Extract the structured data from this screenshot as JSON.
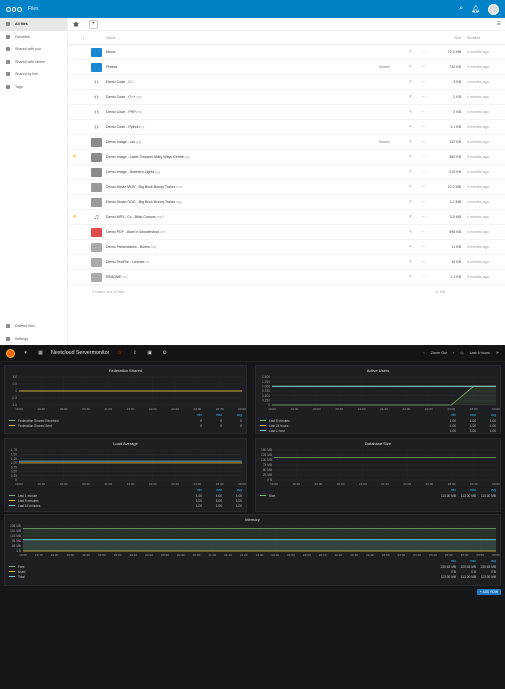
{
  "nextcloud": {
    "app_title": "Files",
    "sidebar": {
      "items": [
        {
          "label": "All files"
        },
        {
          "label": "Favorites"
        },
        {
          "label": "Shared with you"
        },
        {
          "label": "Shared with others"
        },
        {
          "label": "Shared by link"
        },
        {
          "label": "Tags"
        }
      ],
      "bottom_items": [
        {
          "label": "Deleted files"
        },
        {
          "label": "Settings"
        }
      ]
    },
    "list_header": {
      "name": "Name",
      "size": "Size",
      "modified": "Modified"
    },
    "files": [
      {
        "icon": "folder-icon",
        "type": "folder",
        "name": "Music",
        "ext": "",
        "share": "",
        "size": "70.3 MB",
        "modified": "4 months ago",
        "favorite": false
      },
      {
        "icon": "folder-icon",
        "type": "folder",
        "name": "Photos",
        "ext": "",
        "share": "Shared",
        "size": "732 KB",
        "modified": "4 months ago",
        "favorite": false
      },
      {
        "icon": "code-icon",
        "type": "code",
        "name": "Demo Code - C",
        "ext": ".c",
        "share": "",
        "size": "3 KB",
        "modified": "4 months ago",
        "favorite": false
      },
      {
        "icon": "code-icon",
        "type": "code",
        "name": "Demo Code - C++",
        "ext": ".cpp",
        "share": "",
        "size": "2 KB",
        "modified": "4 months ago",
        "favorite": false
      },
      {
        "icon": "code-icon",
        "type": "code",
        "name": "Demo Code - PHP",
        "ext": ".php",
        "share": "",
        "size": "2 KB",
        "modified": "4 months ago",
        "favorite": false
      },
      {
        "icon": "code-icon",
        "type": "code",
        "name": "Demo Code - Python",
        "ext": ".py",
        "share": "",
        "size": "1.1 KB",
        "modified": "4 months ago",
        "favorite": false
      },
      {
        "icon": "image-icon",
        "type": "image",
        "name": "Demo Image - ccc",
        "ext": ".jpg",
        "share": "Shared",
        "size": "132 KB",
        "modified": "4 months ago",
        "favorite": false
      },
      {
        "icon": "image-icon",
        "type": "image",
        "name": "Demo Image - Laser Towards Milky Ways Centre",
        "ext": ".jpg",
        "share": "",
        "size": "360 KB",
        "modified": "4 months ago",
        "favorite": true
      },
      {
        "icon": "image-icon",
        "type": "image",
        "name": "Demo Image - Northern Lights",
        "ext": ".jpg",
        "share": "",
        "size": "219 KB",
        "modified": "4 months ago",
        "favorite": false
      },
      {
        "icon": "video-icon",
        "type": "video",
        "name": "Demo Movie MOV - Big Buck Bunny Trailer",
        "ext": ".mov",
        "share": "",
        "size": "10.2 MB",
        "modified": "4 months ago",
        "favorite": false
      },
      {
        "icon": "video-icon",
        "type": "video",
        "name": "Demo Movie OGG - Big Buck Bunny Trailer",
        "ext": ".ogg",
        "share": "",
        "size": "4.2 MB",
        "modified": "4 months ago",
        "favorite": false
      },
      {
        "icon": "audio-icon",
        "type": "audio",
        "name": "Demo MP3 - Cc - Blick Cursors",
        "ext": ".mp3",
        "share": "",
        "size": "3.5 MB",
        "modified": "4 months ago",
        "favorite": true
      },
      {
        "icon": "pdf-icon",
        "type": "pdf",
        "name": "Demo PDF - Alice in Wonderland",
        "ext": ".pdf",
        "share": "",
        "size": "695 KB",
        "modified": "4 months ago",
        "favorite": false
      },
      {
        "icon": "document-icon",
        "type": "doc",
        "name": "Demo Presentation - Boxes",
        "ext": ".key",
        "share": "",
        "size": "11 KB",
        "modified": "4 months ago",
        "favorite": false
      },
      {
        "icon": "document-icon",
        "type": "doc",
        "name": "Demo TextFile - License",
        "ext": ".txt",
        "share": "",
        "size": "35 KB",
        "modified": "4 months ago",
        "favorite": false
      },
      {
        "icon": "document-icon",
        "type": "doc",
        "name": "README",
        "ext": ".md",
        "share": "",
        "size": "1.1 KB",
        "modified": "4 months ago",
        "favorite": false
      }
    ],
    "summary": {
      "count": "2 folders and 14 files",
      "total": "91 MB"
    }
  },
  "grafana": {
    "dashboard_title": "Nextcloud Servermonitor",
    "zoom_label": "Zoom Out",
    "time_range": "Last 6 hours",
    "add_row": "+ ADD ROW"
  },
  "chart_data": [
    {
      "type": "line",
      "title": "Federation Shared",
      "x": [
        "19:00",
        "19:30",
        "20:00",
        "20:30",
        "21:00",
        "21:30",
        "22:00",
        "22:30",
        "23:00",
        "23:30",
        "00:00"
      ],
      "ylim": [
        -1.0,
        1.0
      ],
      "yticks": [
        "1.0",
        "0.5",
        "0",
        "-0.5",
        "-1.0"
      ],
      "series": [
        {
          "name": "Federation Shared Received",
          "values": [
            0,
            0,
            0,
            0,
            0,
            0,
            0,
            0,
            0,
            0,
            0
          ],
          "color": "#7eb26d",
          "min": "0",
          "max": "0",
          "avg": "0"
        },
        {
          "name": "Federation Shared Sent",
          "values": [
            0,
            0,
            0,
            0,
            0,
            0,
            0,
            0,
            0,
            0,
            0
          ],
          "color": "#eab839",
          "min": "0",
          "max": "0",
          "avg": "0"
        }
      ],
      "legend_headers": [
        "min",
        "max",
        "avg"
      ]
    },
    {
      "type": "line",
      "title": "Active Users",
      "x": [
        "19:00",
        "19:30",
        "20:00",
        "20:30",
        "21:00",
        "21:30",
        "22:00",
        "22:30",
        "23:00",
        "23:30",
        "00:00"
      ],
      "ylim": [
        0,
        1.5
      ],
      "yticks": [
        "1.500",
        "1.250",
        "1.000",
        "0.750",
        "0.500",
        "0.250",
        "0"
      ],
      "series": [
        {
          "name": "Last 5 minutes",
          "values": [
            0,
            0,
            0,
            0,
            0,
            0,
            0,
            0,
            0,
            1.0,
            1.0
          ],
          "color": "#7eb26d",
          "min": "1.00",
          "max": "1.00",
          "avg": "1.00"
        },
        {
          "name": "Last 24 hours",
          "values": [
            1,
            1,
            1,
            1,
            1,
            1,
            1,
            1,
            1,
            1,
            1
          ],
          "color": "#eab839",
          "min": "1.00",
          "max": "1.00",
          "avg": "1.00"
        },
        {
          "name": "Last 1 hour",
          "values": [
            1,
            1,
            1,
            1,
            1,
            1,
            1,
            1,
            1,
            1,
            1
          ],
          "color": "#6ed0e0",
          "min": "1.00",
          "max": "1.00",
          "avg": "1.00"
        }
      ],
      "legend_headers": [
        "min",
        "max",
        "avg"
      ]
    },
    {
      "type": "line",
      "title": "Load Average",
      "x": [
        "19:00",
        "19:30",
        "20:00",
        "20:30",
        "21:00",
        "21:30",
        "22:00",
        "22:30",
        "23:00",
        "23:30",
        "00:00"
      ],
      "ylim": [
        0,
        1.75
      ],
      "yticks": [
        "1.75",
        "1.50",
        "1.25",
        "1.00",
        "0.75",
        "0.50",
        "0.25",
        "0"
      ],
      "series": [
        {
          "name": "Last 1 minute",
          "values": [
            1.0,
            1.0,
            1.0,
            1.0,
            1.0,
            1.0,
            1.0,
            1.0,
            1.0,
            1.0,
            1.0
          ],
          "color": "#7eb26d",
          "min": "1.00",
          "max": "1.00",
          "avg": "1.00"
        },
        {
          "name": "Last 5 minutes",
          "values": [
            1.0,
            1.0,
            1.0,
            1.0,
            1.0,
            1.0,
            1.0,
            1.0,
            1.0,
            1.0,
            1.0
          ],
          "color": "#eab839",
          "min": "1.00",
          "max": "1.00",
          "avg": "1.00"
        },
        {
          "name": "Last 15 minutes",
          "values": [
            1.1,
            1.1,
            1.1,
            1.1,
            1.1,
            1.1,
            1.1,
            1.1,
            1.1,
            1.1,
            1.1
          ],
          "color": "#6ed0e0",
          "min": "1.00",
          "max": "1.00",
          "avg": "1.00"
        }
      ],
      "legend_headers": [
        "min",
        "max",
        "avg"
      ]
    },
    {
      "type": "line",
      "title": "Database Size",
      "x": [
        "19:00",
        "19:30",
        "20:00",
        "20:30",
        "21:00",
        "21:30",
        "22:00",
        "22:30",
        "23:00",
        "23:30",
        "00:00"
      ],
      "ylim": [
        0,
        150
      ],
      "yticks": [
        "150 MB",
        "125 MB",
        "100 MB",
        "75 MB",
        "50 MB",
        "25 MB",
        "0 B"
      ],
      "series": [
        {
          "name": "Size",
          "values": [
            113,
            113,
            113,
            113,
            113,
            113,
            113,
            113,
            113,
            113,
            113
          ],
          "color": "#7eb26d",
          "min": "113.00 MB",
          "max": "113.00 MB",
          "avg": "113.00 MB"
        }
      ],
      "legend_headers": [
        "min",
        "max",
        "avg"
      ]
    },
    {
      "type": "area",
      "title": "Memory",
      "x": [
        "19:00",
        "19:10",
        "19:20",
        "19:30",
        "19:40",
        "19:50",
        "20:00",
        "20:10",
        "20:20",
        "20:30",
        "20:40",
        "20:50",
        "21:00",
        "21:10",
        "21:20",
        "21:30",
        "21:40",
        "21:50",
        "22:00",
        "22:10",
        "22:20",
        "22:30",
        "22:40",
        "22:50",
        "23:00",
        "23:10",
        "23:20",
        "23:30",
        "23:40",
        "23:50",
        "00:00"
      ],
      "ylim": [
        0,
        250
      ],
      "yticks": [
        "238 MB",
        "191 MB",
        "143 MB",
        "95 MB",
        "48 MB",
        "0 B"
      ],
      "series": [
        {
          "name": "Free",
          "values": [
            225,
            225,
            225,
            225,
            225,
            225,
            225,
            225,
            225,
            225,
            225,
            225,
            225,
            225,
            225,
            225,
            225,
            225,
            225,
            225,
            225,
            225,
            225,
            225,
            225,
            225,
            225,
            225,
            225,
            225,
            225
          ],
          "color": "#7eb26d",
          "min": "225.63 MB",
          "max": "225.63 MB",
          "avg": "225.63 MB"
        },
        {
          "name": "Used",
          "values": [
            0,
            0,
            0,
            0,
            0,
            0,
            0,
            0,
            0,
            0,
            0,
            0,
            0,
            0,
            0,
            0,
            0,
            0,
            0,
            0,
            0,
            0,
            0,
            0,
            0,
            0,
            0,
            0,
            0,
            0,
            0
          ],
          "color": "#eab839",
          "min": "0 B",
          "max": "0 B",
          "avg": "0 B"
        },
        {
          "name": "Total",
          "values": [
            113,
            113,
            113,
            113,
            113,
            113,
            113,
            113,
            113,
            113,
            113,
            113,
            113,
            113,
            113,
            113,
            113,
            113,
            113,
            113,
            113,
            113,
            113,
            113,
            113,
            113,
            113,
            113,
            113,
            113,
            113
          ],
          "color": "#6ed0e0",
          "min": "113.00 MB",
          "max": "113.00 MB",
          "avg": "113.00 MB"
        }
      ],
      "legend_headers": [
        "min",
        "max",
        "avg"
      ]
    }
  ]
}
